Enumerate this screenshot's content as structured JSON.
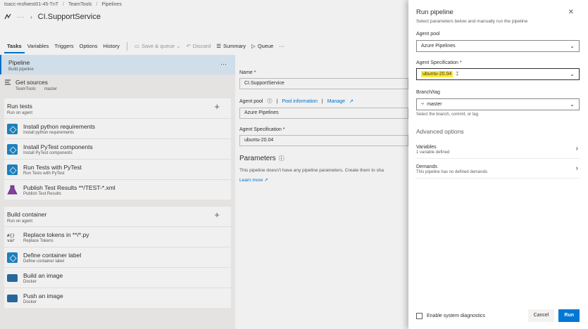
{
  "breadcrumb": {
    "org": "tsacc-msfwest01-45-TnT",
    "project": "TeamTools",
    "section": "Pipelines"
  },
  "header": {
    "title": "CI.SupportService"
  },
  "toolbar": {
    "tabs": [
      "Tasks",
      "Variables",
      "Triggers",
      "Options",
      "History"
    ],
    "save_queue": "Save & queue",
    "discard": "Discard",
    "summary": "Summary",
    "queue": "Queue",
    "more": "···"
  },
  "pipeline": {
    "title": "Pipeline",
    "subtitle": "Build pipeline",
    "more": "···"
  },
  "sources": {
    "title": "Get sources",
    "repo": "TeamTools",
    "branch": "master"
  },
  "jobs": [
    {
      "title": "Run tests",
      "subtitle": "Run on agent",
      "tasks": [
        {
          "title": "Install python requirements",
          "subtitle": "Install python requirements"
        },
        {
          "title": "Install PyTest components",
          "subtitle": "Install PyTest components"
        },
        {
          "title": "Run Tests with PyTest",
          "subtitle": "Run Tests with PyTest"
        },
        {
          "title": "Publish Test Results **/TEST-*.xml",
          "subtitle": "Publish Test Results"
        }
      ]
    },
    {
      "title": "Build container",
      "subtitle": "Run on agent",
      "tasks": [
        {
          "title": "Replace tokens in **/*.py",
          "subtitle": "Replace Tokens"
        },
        {
          "title": "Define container label",
          "subtitle": "Define container label"
        },
        {
          "title": "Build an image",
          "subtitle": "Docker"
        },
        {
          "title": "Push an image",
          "subtitle": "Docker"
        }
      ]
    }
  ],
  "details": {
    "name_label": "Name *",
    "name_value": "CI.SupportService",
    "pool_label": "Agent pool",
    "pool_info": "Pool information",
    "pool_manage": "Manage",
    "pool_value": "Azure Pipelines",
    "spec_label": "Agent Specification *",
    "spec_value": "ubuntu-20.04",
    "params_title": "Parameters",
    "params_text": "This pipeline doesn't have any pipeline parameters. Create them to sha",
    "learn_more": "Learn more"
  },
  "dialog": {
    "title": "Run pipeline",
    "subtitle": "Select parameters below and manually run the pipeline",
    "pool_label": "Agent pool",
    "pool_value": "Azure Pipelines",
    "spec_label": "Agent Specification *",
    "spec_value": "ubuntu-20.04",
    "branch_label": "Branch/tag",
    "branch_value": "master",
    "branch_help": "Select the branch, commit, or tag",
    "advanced": "Advanced options",
    "variables_title": "Variables",
    "variables_sub": "1 variable defined",
    "demands_title": "Demands",
    "demands_sub": "This pipeline has no defined demands",
    "diagnostics": "Enable system diagnostics",
    "cancel": "Cancel",
    "run": "Run"
  },
  "colors": {
    "accent": "#0078d4",
    "highlight": "#ffeb3b"
  }
}
